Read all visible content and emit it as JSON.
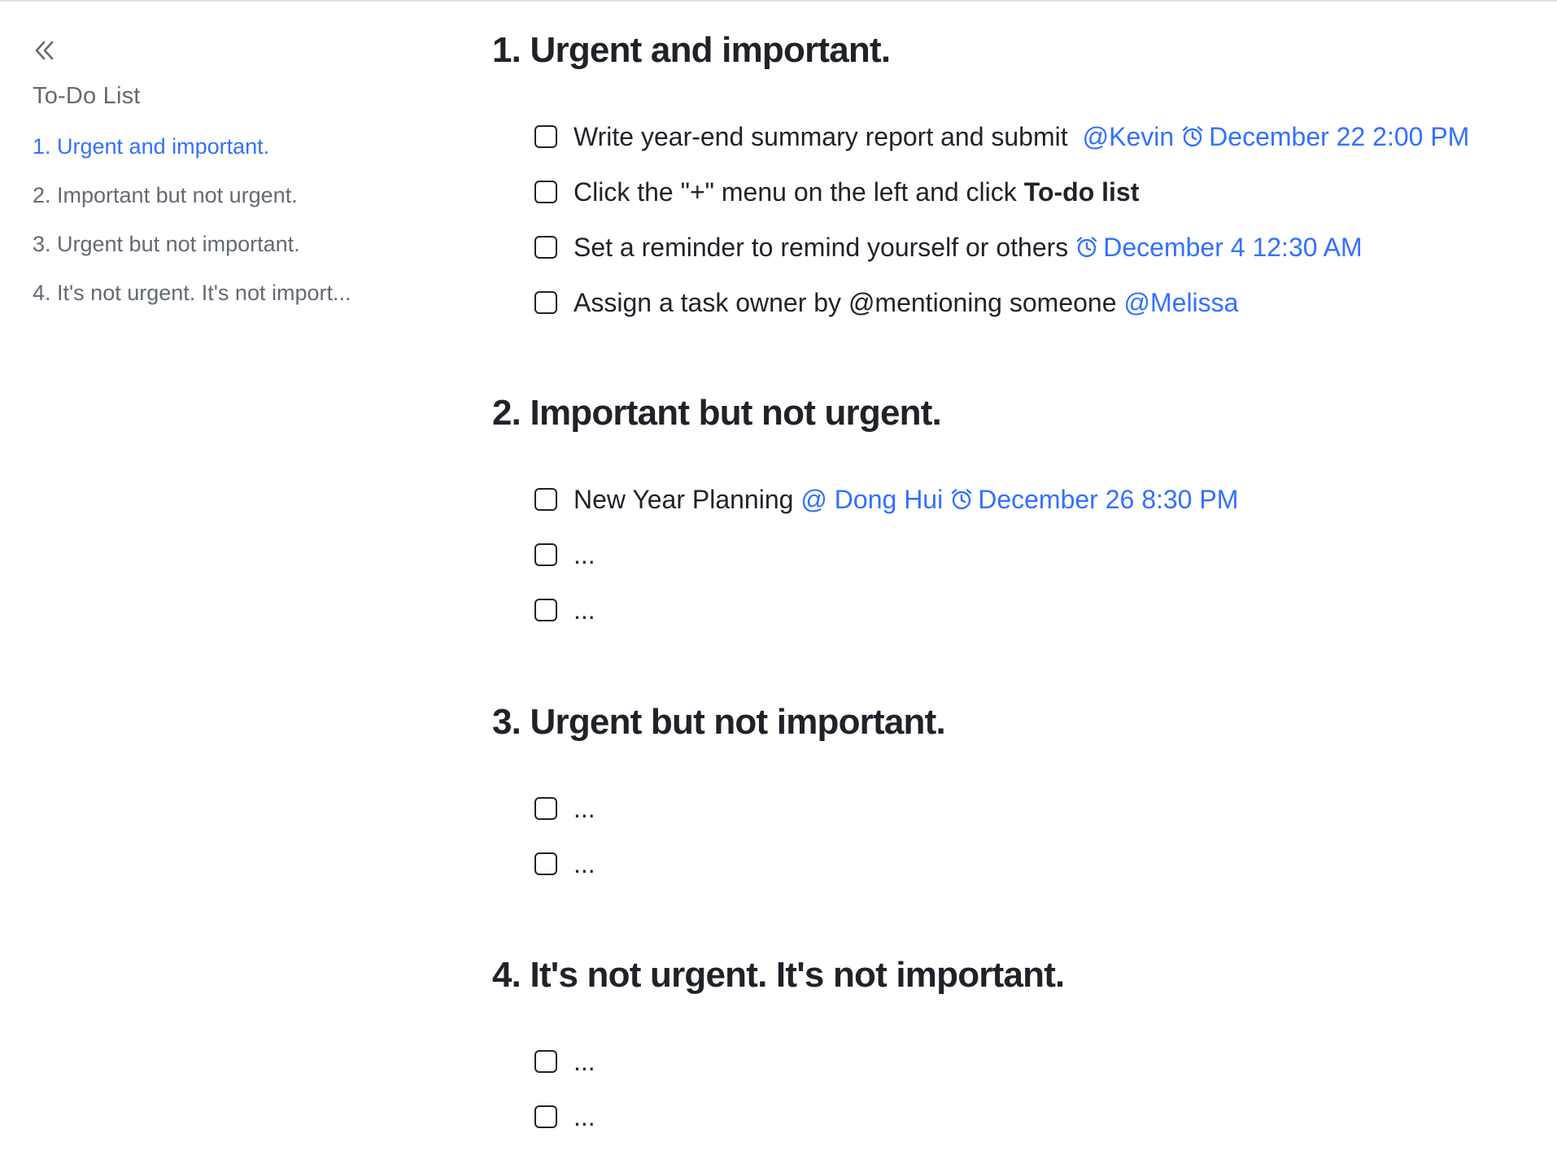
{
  "sidebar": {
    "collapse_icon": "double-chevron-left-icon",
    "title": "To-Do List",
    "items": [
      {
        "label": "1. Urgent and important.",
        "active": true
      },
      {
        "label": "2. Important but not urgent.",
        "active": false
      },
      {
        "label": "3. Urgent but not important.",
        "active": false
      },
      {
        "label": "4. It's not urgent. It's not import...",
        "active": false
      }
    ]
  },
  "colors": {
    "accent": "#3370ff",
    "text": "#1f2329",
    "muted": "#646a73"
  },
  "sections": [
    {
      "heading": "1. Urgent and important.",
      "todos": [
        {
          "text": "Write year-end summary report and submit",
          "mention": "@Kevin",
          "reminder": "December 22 2:00 PM"
        },
        {
          "text_before": "Click the \"+\" menu on the left and click",
          "text_bold": "To-do list"
        },
        {
          "text": "Set a reminder to remind yourself or others",
          "reminder": "December 4 12:30 AM"
        },
        {
          "text": "Assign a task owner by @mentioning someone",
          "mention": "@Melissa"
        }
      ]
    },
    {
      "heading": "2. Important but not urgent.",
      "todos": [
        {
          "text": "New Year Planning",
          "mention": "@ Dong Hui",
          "reminder": "December 26 8:30 PM"
        },
        {
          "text": "..."
        },
        {
          "text": "..."
        }
      ]
    },
    {
      "heading": "3. Urgent but not important.",
      "todos": [
        {
          "text": "..."
        },
        {
          "text": "..."
        }
      ]
    },
    {
      "heading": "4. It's not urgent. It's not important.",
      "todos": [
        {
          "text": "..."
        },
        {
          "text": "..."
        }
      ]
    }
  ]
}
